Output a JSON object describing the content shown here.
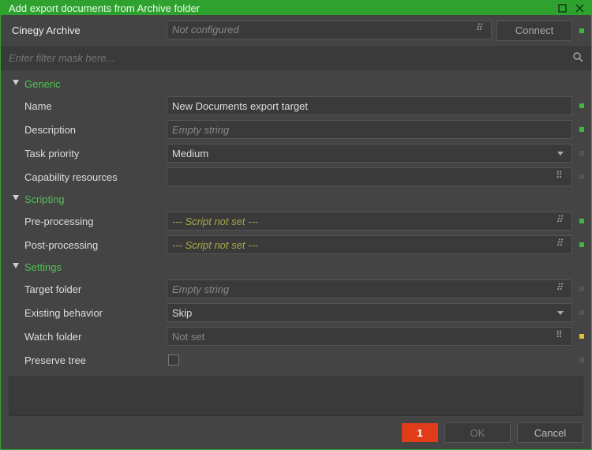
{
  "window": {
    "title": "Add export documents from Archive folder"
  },
  "archive": {
    "label": "Cinegy Archive",
    "value_placeholder": "Not configured",
    "connect_label": "Connect"
  },
  "filter": {
    "placeholder": "Enter filter mask here..."
  },
  "groups": {
    "generic": {
      "title": "Generic"
    },
    "scripting": {
      "title": "Scripting"
    },
    "settings": {
      "title": "Settings"
    }
  },
  "fields": {
    "name": {
      "label": "Name",
      "value": "New Documents export target"
    },
    "description": {
      "label": "Description",
      "placeholder": "Empty string"
    },
    "task_priority": {
      "label": "Task priority",
      "value": "Medium"
    },
    "capability_resources": {
      "label": "Capability resources",
      "value": ""
    },
    "pre_processing": {
      "label": "Pre-processing",
      "placeholder": "--- Script not set ---"
    },
    "post_processing": {
      "label": "Post-processing",
      "placeholder": "--- Script not set ---"
    },
    "target_folder": {
      "label": "Target folder",
      "placeholder": "Empty string"
    },
    "existing_behavior": {
      "label": "Existing behavior",
      "value": "Skip"
    },
    "watch_folder": {
      "label": "Watch folder",
      "placeholder": "Not set"
    },
    "preserve_tree": {
      "label": "Preserve tree"
    }
  },
  "footer": {
    "error_count": "1",
    "ok_label": "OK",
    "cancel_label": "Cancel"
  }
}
